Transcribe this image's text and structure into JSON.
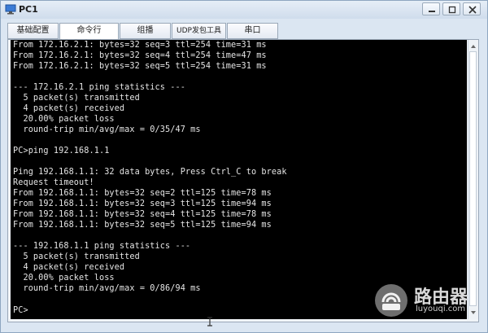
{
  "window": {
    "title": "PC1"
  },
  "tabs": [
    {
      "label": "基础配置",
      "active": false
    },
    {
      "label": "命令行",
      "active": true
    },
    {
      "label": "组播",
      "active": false
    },
    {
      "label": "UDP发包工具",
      "active": false
    },
    {
      "label": "串口",
      "active": false
    }
  ],
  "terminal": {
    "lines": [
      "From 172.16.2.1: bytes=32 seq=3 ttl=254 time=31 ms",
      "From 172.16.2.1: bytes=32 seq=4 ttl=254 time=47 ms",
      "From 172.16.2.1: bytes=32 seq=5 ttl=254 time=31 ms",
      "",
      "--- 172.16.2.1 ping statistics ---",
      "  5 packet(s) transmitted",
      "  4 packet(s) received",
      "  20.00% packet loss",
      "  round-trip min/avg/max = 0/35/47 ms",
      "",
      "PC>ping 192.168.1.1",
      "",
      "Ping 192.168.1.1: 32 data bytes, Press Ctrl_C to break",
      "Request timeout!",
      "From 192.168.1.1: bytes=32 seq=2 ttl=125 time=78 ms",
      "From 192.168.1.1: bytes=32 seq=3 ttl=125 time=94 ms",
      "From 192.168.1.1: bytes=32 seq=4 ttl=125 time=78 ms",
      "From 192.168.1.1: bytes=32 seq=5 ttl=125 time=94 ms",
      "",
      "--- 192.168.1.1 ping statistics ---",
      "  5 packet(s) transmitted",
      "  4 packet(s) received",
      "  20.00% packet loss",
      "  round-trip min/avg/max = 0/86/94 ms",
      "",
      "",
      "PC>"
    ]
  },
  "watermark": {
    "text": "路由器",
    "sub": "luyouqi.com"
  },
  "colors": {
    "terminal_bg": "#000000",
    "terminal_fg": "#e6e6e6",
    "titlebar": "#dbe6f2"
  },
  "icons": [
    "app-icon",
    "minimize-icon",
    "maximize-icon",
    "close-icon",
    "scroll-up-icon",
    "scroll-down-icon",
    "text-cursor-icon"
  ]
}
